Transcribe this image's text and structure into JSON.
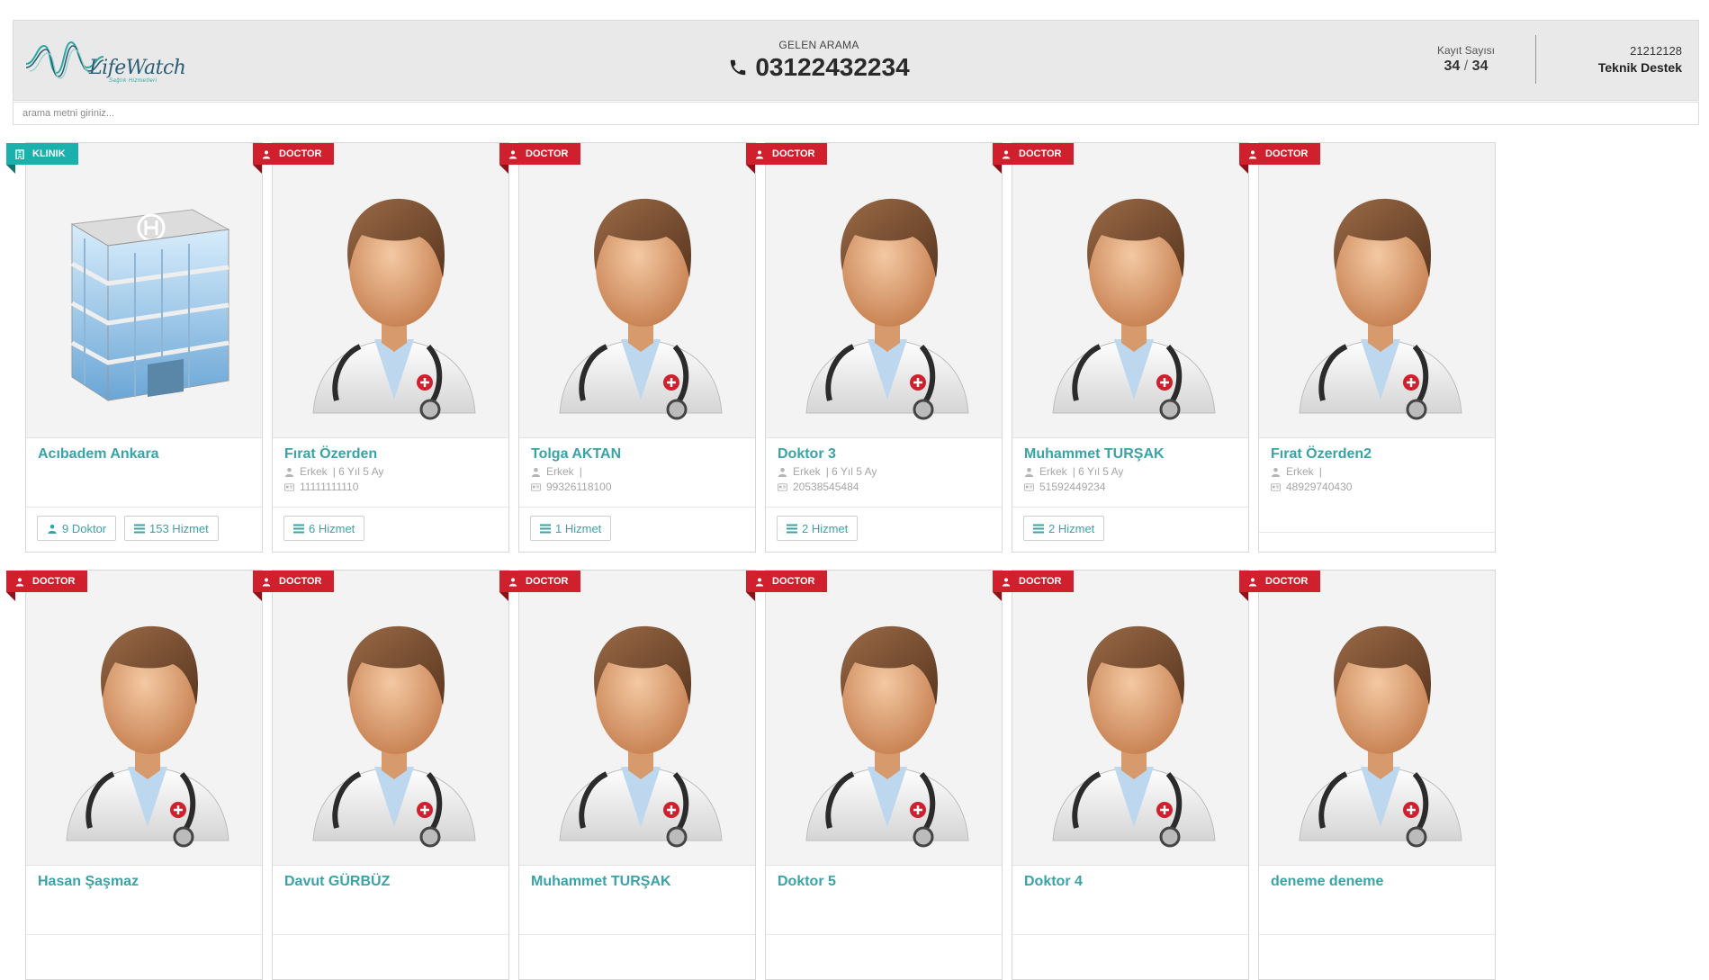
{
  "header": {
    "logo_text": "LifeWatch",
    "logo_subtitle": "Sağlık Hizmetleri",
    "incoming_label": "GELEN ARAMA",
    "phone_number": "03122432234",
    "records_label": "Kayıt Sayısı",
    "records_current": "34",
    "records_separator": "/",
    "records_total": "34",
    "user_id": "21212128",
    "user_name": "Teknik Destek"
  },
  "search": {
    "placeholder": "arama metni giriniz...",
    "value": ""
  },
  "colors": {
    "accent": "#3aa3a8",
    "doctor_ribbon": "#d0202d",
    "clinic_ribbon": "#1ab0ac",
    "header_bg": "#e9e9e9"
  },
  "cards": [
    {
      "type": "KLINIK",
      "icon": "hospital-building-icon",
      "name": "Acıbadem Ankara",
      "gender": "",
      "experience": "",
      "id_number": "",
      "buttons": [
        {
          "label": "9 Doktor",
          "icon": "user-icon"
        },
        {
          "label": "153 Hizmet",
          "icon": "list-icon"
        }
      ]
    },
    {
      "type": "DOCTOR",
      "icon": "doctor-avatar-icon",
      "name": "Fırat Özerden",
      "gender": "Erkek",
      "experience": "| 6 Yıl 5 Ay",
      "id_number": "11111111110",
      "buttons": [
        {
          "label": "6 Hizmet",
          "icon": "list-icon"
        }
      ]
    },
    {
      "type": "DOCTOR",
      "icon": "doctor-avatar-icon",
      "name": "Tolga AKTAN",
      "gender": "Erkek",
      "experience": "|",
      "id_number": "99326118100",
      "buttons": [
        {
          "label": "1 Hizmet",
          "icon": "list-icon"
        }
      ]
    },
    {
      "type": "DOCTOR",
      "icon": "doctor-avatar-icon",
      "name": "Doktor 3",
      "gender": "Erkek",
      "experience": "| 6 Yıl 5 Ay",
      "id_number": "20538545484",
      "buttons": [
        {
          "label": "2 Hizmet",
          "icon": "list-icon"
        }
      ]
    },
    {
      "type": "DOCTOR",
      "icon": "doctor-avatar-icon",
      "name": "Muhammet TURŞAK",
      "gender": "Erkek",
      "experience": "| 6 Yıl 5 Ay",
      "id_number": "51592449234",
      "buttons": [
        {
          "label": "2 Hizmet",
          "icon": "list-icon"
        }
      ]
    },
    {
      "type": "DOCTOR",
      "icon": "doctor-avatar-icon",
      "name": "Fırat Özerden2",
      "gender": "Erkek",
      "experience": "|",
      "id_number": "48929740430",
      "buttons": []
    },
    {
      "type": "DOCTOR",
      "icon": "doctor-avatar-icon",
      "name": "Hasan Şaşmaz",
      "gender": "",
      "experience": "",
      "id_number": "",
      "buttons": []
    },
    {
      "type": "DOCTOR",
      "icon": "doctor-avatar-icon",
      "name": "Davut GÜRBÜZ",
      "gender": "",
      "experience": "",
      "id_number": "",
      "buttons": []
    },
    {
      "type": "DOCTOR",
      "icon": "doctor-avatar-icon",
      "name": "Muhammet TURŞAK",
      "gender": "",
      "experience": "",
      "id_number": "",
      "buttons": []
    },
    {
      "type": "DOCTOR",
      "icon": "doctor-avatar-icon",
      "name": "Doktor 5",
      "gender": "",
      "experience": "",
      "id_number": "",
      "buttons": []
    },
    {
      "type": "DOCTOR",
      "icon": "doctor-avatar-icon",
      "name": "Doktor 4",
      "gender": "",
      "experience": "",
      "id_number": "",
      "buttons": []
    },
    {
      "type": "DOCTOR",
      "icon": "doctor-avatar-icon",
      "name": "deneme deneme",
      "gender": "",
      "experience": "",
      "id_number": "",
      "buttons": []
    }
  ]
}
